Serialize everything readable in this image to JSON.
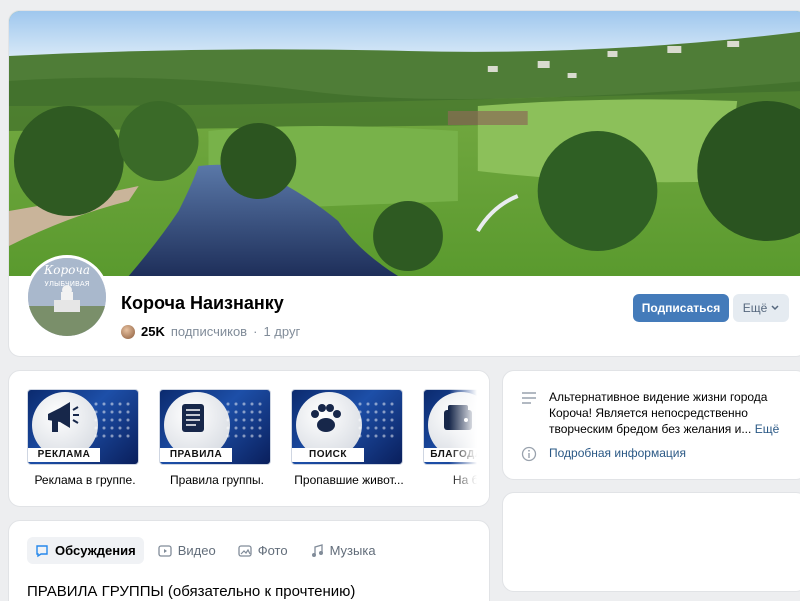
{
  "header": {
    "group_name": "Короча Наизнанку",
    "subscribers_count": "25K",
    "subscribers_label": "подписчиков",
    "separator": "·",
    "friends": "1 друг",
    "avatar_text_top": "Короча",
    "avatar_text_bottom": "УЛЫБЧИВАЯ",
    "subscribe_label": "Подписаться",
    "more_label": "Ещё"
  },
  "links": [
    {
      "plate": "РЕКЛАМА",
      "caption": "Реклама в группе.",
      "icon": "megaphone-icon"
    },
    {
      "plate": "ПРАВИЛА",
      "caption": "Правила группы.",
      "icon": "scroll-icon"
    },
    {
      "plate": "ПОИСК",
      "caption": "Пропавшие живот...",
      "icon": "paw-icon"
    },
    {
      "plate": "БЛАГОДАР",
      "caption": "На благое",
      "icon": "wallet-icon"
    }
  ],
  "tabs": [
    {
      "label": "Обсуждения",
      "icon": "chat-icon",
      "active": true
    },
    {
      "label": "Видео",
      "icon": "play-icon"
    },
    {
      "label": "Фото",
      "icon": "photo-icon"
    },
    {
      "label": "Музыка",
      "icon": "music-icon"
    }
  ],
  "post_title": "ПРАВИЛА ГРУППЫ (обязательно к прочтению)",
  "info": {
    "description": "Альтернативное видение жизни города Короча! Является непосредственно творческим бредом без желания и...",
    "more": "Ещё",
    "detail_link": "Подробная информация"
  },
  "colors": {
    "accent": "#447bba",
    "link": "#2a5885",
    "background": "#edeef0"
  }
}
